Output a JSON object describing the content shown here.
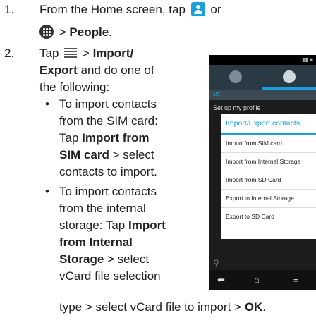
{
  "step1": {
    "num": "1.",
    "line1": "From the Home screen, tap",
    "or": "or",
    "gt": ">",
    "people": "People",
    "period": "."
  },
  "step2": {
    "num": "2.",
    "tap": "Tap",
    "gt1": ">",
    "import_export_1": "Import/",
    "import_export_2": "Export",
    "and_do": "and do one of",
    "following": "the following:",
    "bullet_a": {
      "l1": "To import contacts",
      "l2": "from the SIM card:",
      "l3_tap": "Tap",
      "l3_bold": "Import from",
      "l4_bold": "SIM card",
      "l4_rest": "> select",
      "l5": "contacts to import."
    },
    "bullet_b": {
      "l1": "To import contacts",
      "l2": "from the internal",
      "l3_rest": "storage: Tap",
      "l3_bold": "Import",
      "l4_bold": "from Internal",
      "l5_bold": "Storage",
      "l5_rest": "> select",
      "l6": "vCard file selection",
      "l7": "type > select vCard file to import >",
      "l7_bold": "OK",
      "l7_end": "."
    }
  },
  "phone": {
    "me_label": "ME",
    "setup_profile": "Set up my profile",
    "dialog_title": "Import/Export contacts",
    "dialog_items": [
      "Import from SIM card",
      "Import from Internal Storage",
      "Import from SD Card",
      "Export to Internal Storage",
      "Export to SD Card"
    ],
    "accent_color": "#1aa0dc"
  },
  "icons": [
    "contacts-app-icon",
    "all-apps-icon",
    "menu-icon",
    "search-icon",
    "back-icon",
    "home-icon",
    "recent-apps-icon"
  ]
}
